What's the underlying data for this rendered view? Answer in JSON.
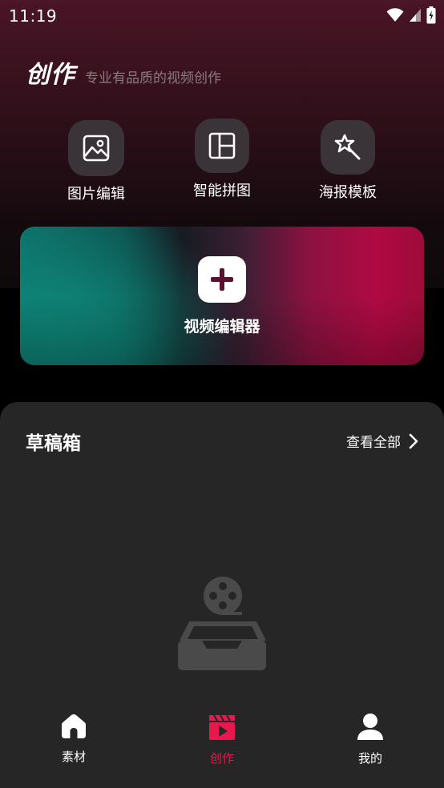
{
  "status_bar": {
    "time": "11:19"
  },
  "brand": {
    "title": "创作",
    "subtitle": "专业有品质的视频创作"
  },
  "tools": [
    {
      "label": "图片编辑",
      "icon": "image-icon"
    },
    {
      "label": "智能拼图",
      "icon": "layout-icon"
    },
    {
      "label": "海报模板",
      "icon": "magic-wand-icon"
    }
  ],
  "editor_card": {
    "label": "视频编辑器"
  },
  "drafts": {
    "title": "草稿箱",
    "view_all": "查看全部"
  },
  "tabbar": {
    "items": [
      {
        "label": "素材",
        "icon": "home-icon",
        "active": false
      },
      {
        "label": "创作",
        "icon": "clapperboard-icon",
        "active": true
      },
      {
        "label": "我的",
        "icon": "user-icon",
        "active": false
      }
    ]
  },
  "colors": {
    "accent": "#e8184f",
    "card_bg": "#262626",
    "icon_tile": "#3a3337"
  }
}
